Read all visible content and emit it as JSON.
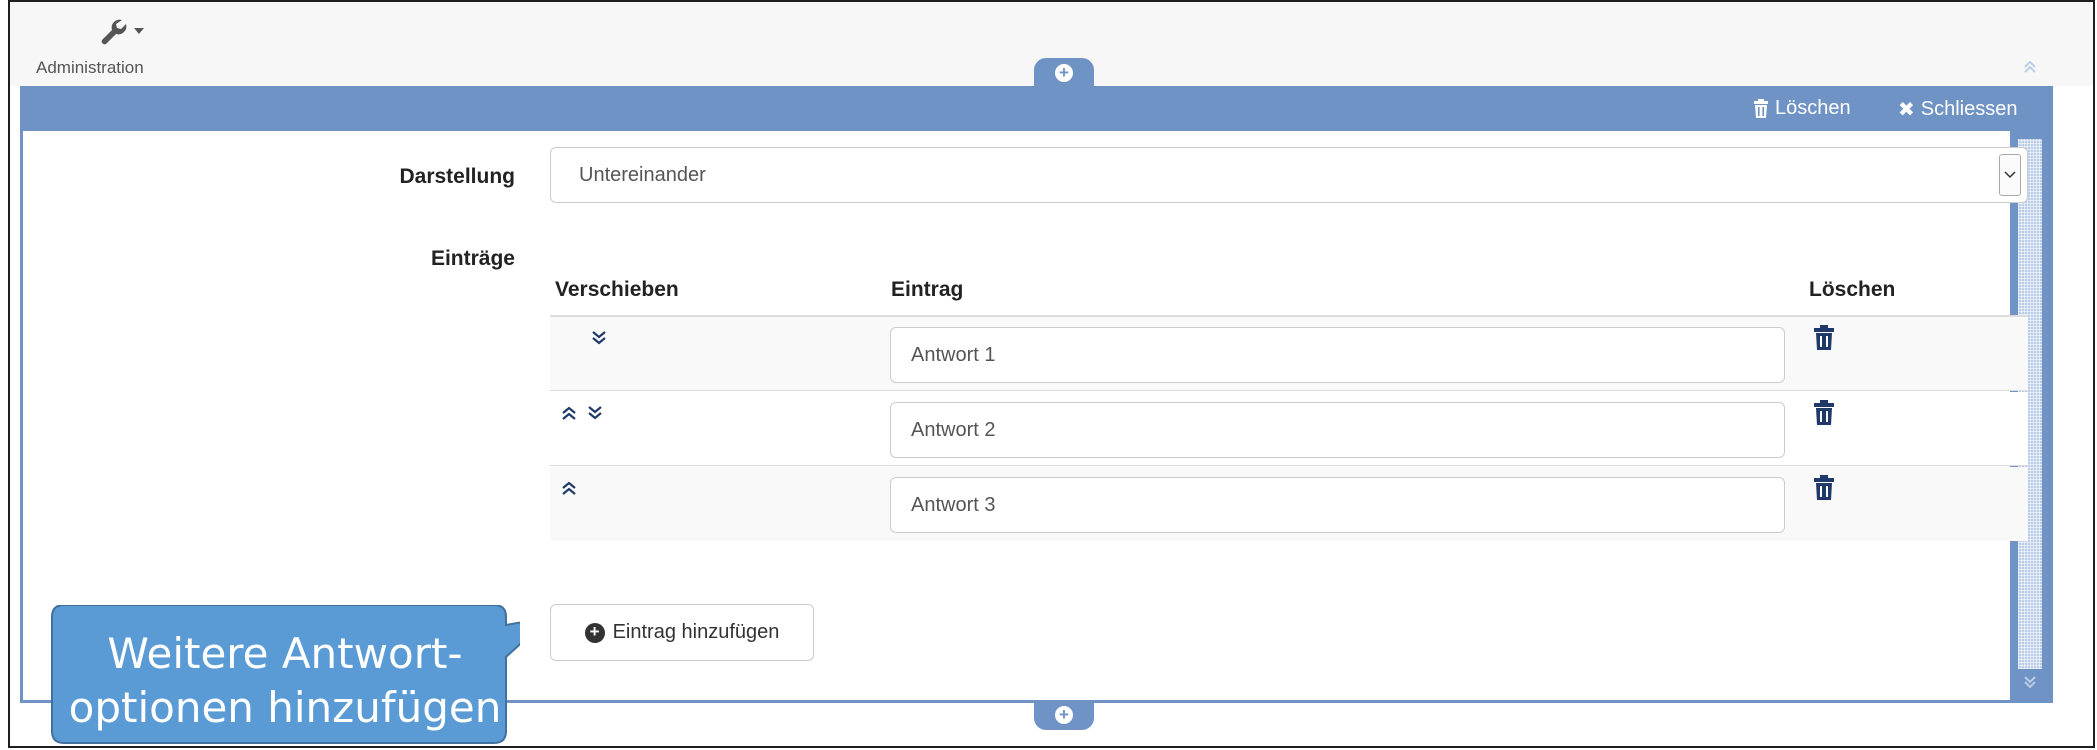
{
  "toolbar": {
    "admin_label": "Administration",
    "admin_icon": "wrench-icon"
  },
  "panel": {
    "header": {
      "delete_label": "Löschen",
      "close_label": "Schliessen"
    },
    "colors": {
      "header": "#6f93c4",
      "border": "#6f93c4",
      "icon_dark": "#1f3a6a"
    }
  },
  "form": {
    "darstellung": {
      "label": "Darstellung",
      "selected": "Untereinander"
    },
    "eintraege": {
      "label": "Einträge",
      "columns": [
        "Verschieben",
        "Eintrag",
        "Löschen"
      ],
      "rows": [
        {
          "value": "Antwort 1",
          "move": [
            "down"
          ]
        },
        {
          "value": "Antwort 2",
          "move": [
            "up",
            "down"
          ]
        },
        {
          "value": "Antwort 3",
          "move": [
            "up"
          ]
        }
      ]
    },
    "add_button": "Eintrag hinzufügen"
  },
  "callout": {
    "line1": "Weitere Antwort-",
    "line2": "optionen hinzufügen",
    "color": "#5b9bd5"
  }
}
